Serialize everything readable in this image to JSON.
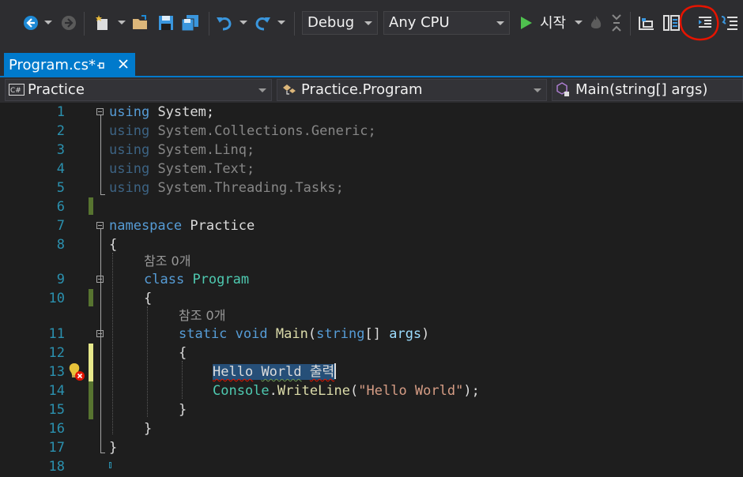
{
  "toolbar": {
    "config": "Debug",
    "platform": "Any CPU",
    "start_label": "시작",
    "icons": [
      "back-arrow-icon",
      "forward-arrow-icon",
      "new-project-icon",
      "open-folder-icon",
      "save-icon",
      "save-all-icon",
      "undo-icon",
      "redo-icon",
      "run-icon",
      "hot-reload-icon",
      "step-icon",
      "toolbox-icon",
      "indent-icon",
      "comment-icon"
    ]
  },
  "tab": {
    "title": "Program.cs*"
  },
  "nav": {
    "project": "Practice",
    "class": "Practice.Program",
    "member": "Main(string[] args)"
  },
  "editor": {
    "line_numbers": [
      "1",
      "2",
      "3",
      "4",
      "5",
      "6",
      "7",
      "8",
      "9",
      "10",
      "11",
      "12",
      "13",
      "14",
      "15",
      "16",
      "17",
      "18"
    ],
    "lines": {
      "l1": "System;",
      "l2": "System.Collections.Generic;",
      "l3": "System.Linq;",
      "l4": "System.Text;",
      "l5": "System.Threading.Tasks;",
      "using_kw": "using",
      "namespace_kw": "namespace",
      "namespace_name": "Practice",
      "open_brace": "{",
      "close_brace": "}",
      "class_kw": "class",
      "class_name": "Program",
      "static_kw": "static",
      "void_kw": "void",
      "method_name": "Main",
      "string_kw": "string",
      "args_text": "args",
      "selected_text_hello": "Hello",
      "selected_text_world": "World",
      "selected_text_korean": "출력",
      "console": "Console",
      "writeline": "WriteLine",
      "string_literal": "\"Hello World\""
    },
    "codelens_ref": "참조 0개"
  },
  "colors": {
    "keyword": "#569cd6",
    "type": "#4ec9b0",
    "method": "#dcdcaa",
    "param": "#9cdcfe",
    "string": "#d69d85",
    "line_number": "#2b91af",
    "accent": "#007acc",
    "annotation": "#e51400"
  }
}
